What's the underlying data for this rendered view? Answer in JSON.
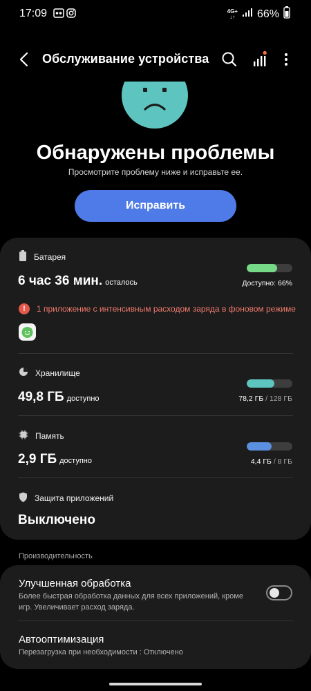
{
  "status_bar": {
    "time": "17:09",
    "network": [
      "4G+",
      "↓↑"
    ],
    "battery": "66%"
  },
  "header": {
    "title": "Обслуживание устройства"
  },
  "hero": {
    "title": "Обнаружены проблемы",
    "subtitle": "Просмотрите проблему ниже и исправьте ее.",
    "fix_button": "Исправить",
    "face_color": "#5ec4c0",
    "button_color": "#4f7be8"
  },
  "battery": {
    "label": "Батарея",
    "value": "6 час 36 мин.",
    "value_suffix": "осталось",
    "caption": "Доступно: 66%",
    "level": 0.66,
    "bar_color": "#76d987",
    "warning": "1 приложение с интенсивным расходом заряда в фоновом режиме"
  },
  "storage": {
    "label": "Хранилище",
    "value": "49,8 ГБ",
    "value_suffix": "доступно",
    "used": "78,2 ГБ",
    "total": "/ 128 ГБ",
    "level": 0.61,
    "bar_color": "#5ec4c0"
  },
  "memory": {
    "label": "Память",
    "value": "2,9 ГБ",
    "value_suffix": "доступно",
    "used": "4,4 ГБ",
    "total": "/ 8 ГБ",
    "level": 0.55,
    "bar_color": "#5b8fe0"
  },
  "protection": {
    "label": "Защита приложений",
    "value": "Выключено"
  },
  "performance": {
    "section_label": "Производительность",
    "enhanced": {
      "title": "Улучшенная обработка",
      "description": "Более быстрая обработка данных для всех приложений, кроме игр. Увеличивает расход заряда.",
      "enabled": false
    },
    "auto_opt": {
      "title": "Автооптимизация",
      "description": "Перезагрузка при необходимости : Отключено"
    }
  }
}
